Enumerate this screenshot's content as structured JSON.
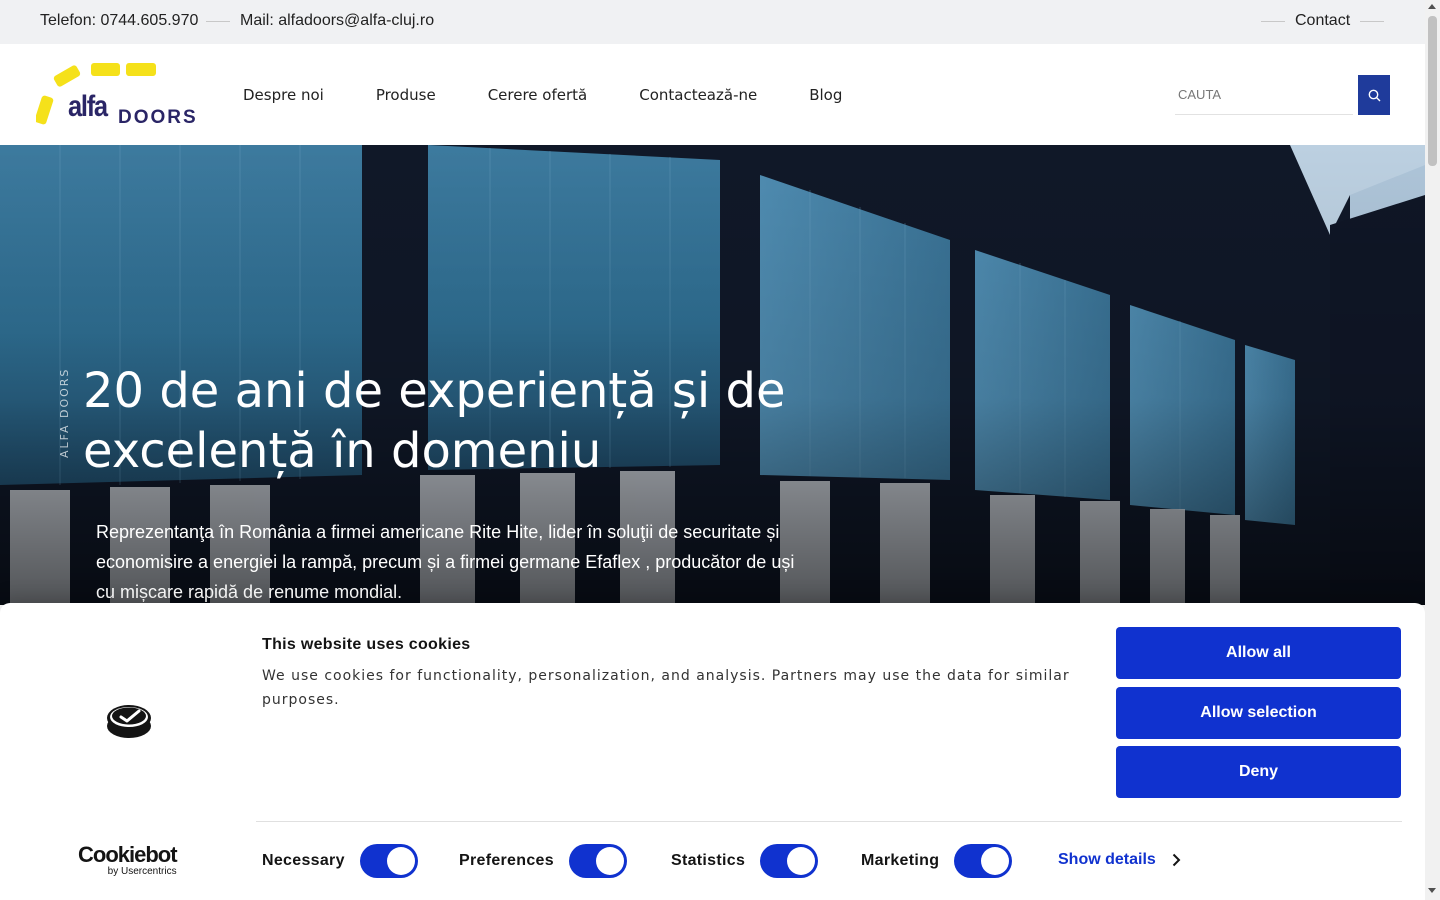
{
  "topbar": {
    "phone": "Telefon: 0744.605.970",
    "mail": "Mail: alfadoors@alfa-cluj.ro",
    "contact": "Contact"
  },
  "header": {
    "logo": {
      "alfa": "alfa",
      "doors": "DOORS",
      "accent_color": "#f5e11a",
      "text_color": "#2a2566"
    },
    "nav": [
      "Despre noi",
      "Produse",
      "Cerere ofertă",
      "Contactează-ne",
      "Blog"
    ],
    "search": {
      "placeholder": "CAUTA",
      "icon": "search-icon",
      "button_color": "#1f3b9b"
    }
  },
  "hero": {
    "side_label": "ALFA DOORS",
    "title": "20 de ani de experiență și de excelență în domeniu",
    "description": "Reprezentanţa în România a firmei americane Rite Hite, lider în soluţii de securitate și economisire a energiei la rampă, precum și a firmei germane Efaflex , producător de uși cu mișcare rapidă de renume mondial."
  },
  "cookie_banner": {
    "title": "This website uses cookies",
    "description": "We use cookies for functionality, personalization, and analysis. Partners may use the data for similar purposes.",
    "brand": {
      "name": "Cookiebot",
      "by": "by Usercentrics"
    },
    "buttons": {
      "allow_all": "Allow all",
      "allow_selection": "Allow selection",
      "deny": "Deny"
    },
    "toggles": [
      {
        "label": "Necessary",
        "checked": true
      },
      {
        "label": "Preferences",
        "checked": true
      },
      {
        "label": "Statistics",
        "checked": true
      },
      {
        "label": "Marketing",
        "checked": true
      }
    ],
    "show_details": "Show details",
    "accent_color": "#1032cf"
  }
}
